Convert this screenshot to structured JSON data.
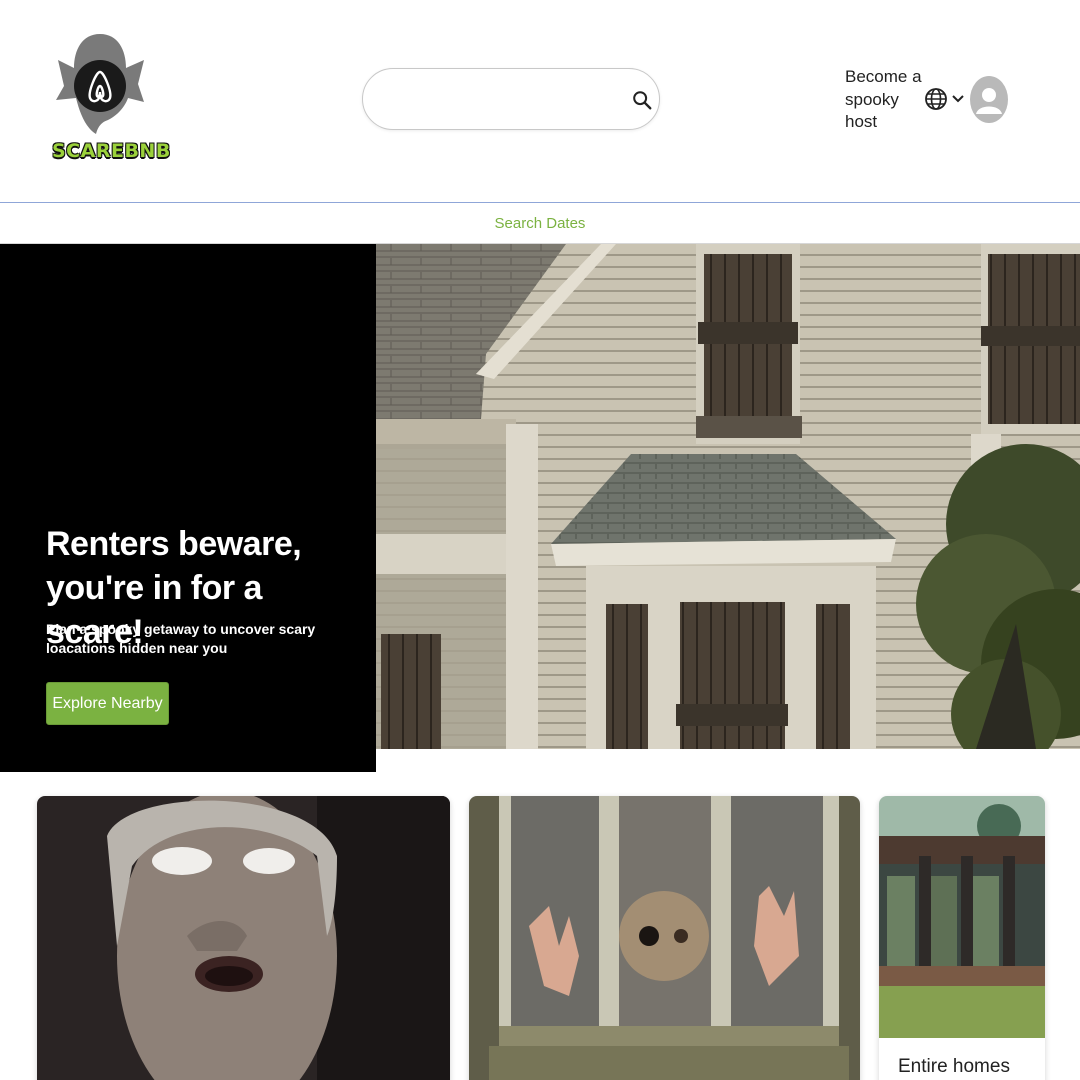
{
  "brand": {
    "name": "SCAREBNB",
    "accent": "#7bb241",
    "logo_text_color": "#9bd13b"
  },
  "header": {
    "search": {
      "placeholder": "",
      "value": "",
      "icon": "search-icon"
    },
    "host_link": "Become a spooky host",
    "language_icon": "globe-icon",
    "menu_icon": "chevron-down-icon",
    "avatar_icon": "user-avatar-icon"
  },
  "search_dates": {
    "label": "Search Dates"
  },
  "hero": {
    "title": "Renters beware, you're in for a scare!",
    "subtitle": "Plan a spooky getaway to uncover scary loacations hidden near you",
    "button_label": "Explore Nearby",
    "image": "haunted-house-photo"
  },
  "cards": [
    {
      "image": "old-man-white-eyes-photo",
      "label": ""
    },
    {
      "image": "creepy-doll-window-photo",
      "label": ""
    },
    {
      "image": "abandoned-porch-photo",
      "label": "Entire homes"
    }
  ]
}
